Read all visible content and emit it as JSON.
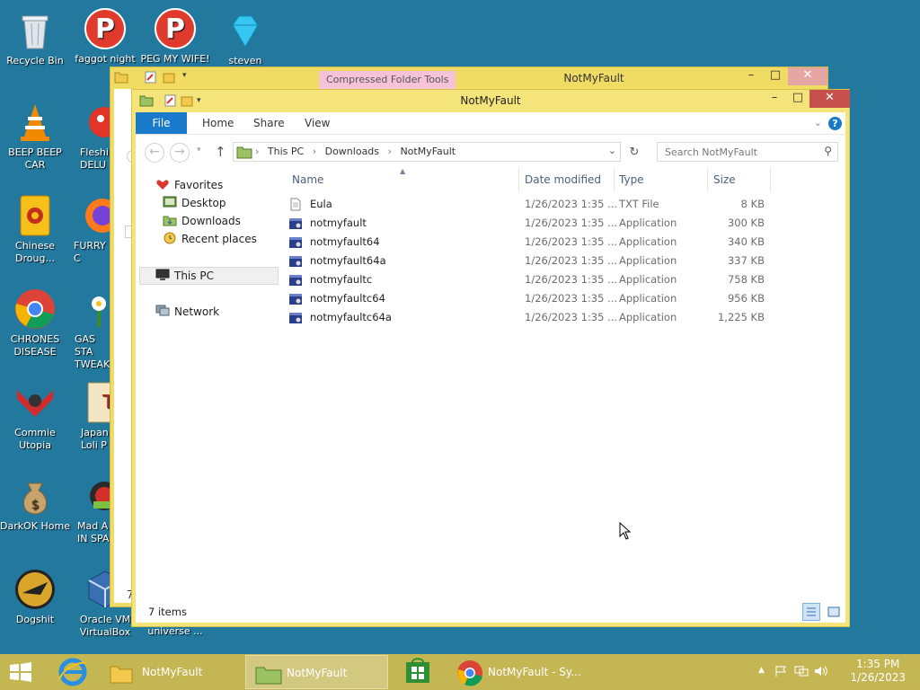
{
  "desktop": {
    "icons": [
      {
        "label": "Recycle Bin",
        "icon": "recycle-bin-icon"
      },
      {
        "label": "faggot night",
        "icon": "app-p-icon"
      },
      {
        "label": "PEG MY WIFE!",
        "icon": "app-p-icon"
      },
      {
        "label": "steven",
        "icon": "diamond-icon"
      },
      {
        "label": "BEEP BEEP CAR",
        "icon": "vlc-cone-icon"
      },
      {
        "label": "Fleshi DELU",
        "icon": "red-creature-icon"
      },
      {
        "label": "Chinese Droug...",
        "icon": "mahjong-tile-icon"
      },
      {
        "label": "FURRY C",
        "icon": "firefox-icon"
      },
      {
        "label": "CHRONES DISEASE",
        "icon": "chrome-icon"
      },
      {
        "label": "GAS STA TWEAK",
        "icon": "flower-icon"
      },
      {
        "label": "Commie Utopia",
        "icon": "red-emblem-icon"
      },
      {
        "label": "Japan Loli P",
        "icon": "japanese-app-icon"
      },
      {
        "label": "DarkOK Home",
        "icon": "money-bag-icon"
      },
      {
        "label": "Mad A IN SPA",
        "icon": "angry-birds-icon"
      },
      {
        "label": "Dogshit",
        "icon": "gold-bird-icon"
      },
      {
        "label": "Oracle VM VirtualBox",
        "icon": "virtualbox-icon"
      },
      {
        "label": "universe ...",
        "icon": "blank-icon"
      }
    ]
  },
  "back_window": {
    "context_tab": "Compressed Folder Tools",
    "title": "NotMyFault",
    "status_fragment": "7"
  },
  "window": {
    "title": "NotMyFault",
    "tabs": [
      "File",
      "Home",
      "Share",
      "View"
    ],
    "address": {
      "crumbs": [
        "This PC",
        "Downloads",
        "NotMyFault"
      ],
      "search_placeholder": "Search NotMyFault"
    },
    "nav": {
      "favorites": "Favorites",
      "favorites_items": [
        "Desktop",
        "Downloads",
        "Recent places"
      ],
      "this_pc": "This PC",
      "network": "Network"
    },
    "columns": [
      "Name",
      "Date modified",
      "Type",
      "Size"
    ],
    "files": [
      {
        "name": "Eula",
        "date": "1/26/2023 1:35 ...",
        "type": "TXT File",
        "size": "8 KB",
        "icon": "text-file-icon"
      },
      {
        "name": "notmyfault",
        "date": "1/26/2023 1:35 ...",
        "type": "Application",
        "size": "300 KB",
        "icon": "application-icon"
      },
      {
        "name": "notmyfault64",
        "date": "1/26/2023 1:35 ...",
        "type": "Application",
        "size": "340 KB",
        "icon": "application-icon"
      },
      {
        "name": "notmyfault64a",
        "date": "1/26/2023 1:35 ...",
        "type": "Application",
        "size": "337 KB",
        "icon": "application-icon"
      },
      {
        "name": "notmyfaultc",
        "date": "1/26/2023 1:35 ...",
        "type": "Application",
        "size": "758 KB",
        "icon": "application-icon"
      },
      {
        "name": "notmyfaultc64",
        "date": "1/26/2023 1:35 ...",
        "type": "Application",
        "size": "956 KB",
        "icon": "application-icon"
      },
      {
        "name": "notmyfaultc64a",
        "date": "1/26/2023 1:35 ...",
        "type": "Application",
        "size": "1,225 KB",
        "icon": "application-icon"
      }
    ],
    "status": "7 items"
  },
  "taskbar": {
    "items": [
      {
        "label": "NotMyFault",
        "icon": "folder-icon"
      },
      {
        "label": "NotMyFault",
        "icon": "folder-icon"
      },
      {
        "label": "NotMyFault - Sy...",
        "icon": "chrome-icon"
      }
    ],
    "clock_time": "1:35 PM",
    "clock_date": "1/26/2023"
  },
  "colors": {
    "desktop": "#23789e",
    "titlebar": "#f5e47a",
    "taskbar": "#c5b654",
    "file_tab": "#1979ca",
    "close_button": "#c7504d"
  }
}
